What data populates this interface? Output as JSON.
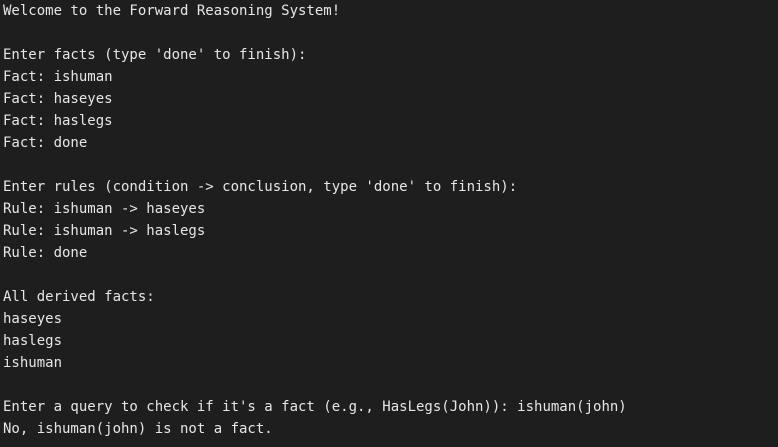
{
  "terminal": {
    "lines": [
      "Welcome to the Forward Reasoning System!",
      "",
      "Enter facts (type 'done' to finish):",
      "Fact: ishuman",
      "Fact: haseyes",
      "Fact: haslegs",
      "Fact: done",
      "",
      "Enter rules (condition -> conclusion, type 'done' to finish):",
      "Rule: ishuman -> haseyes",
      "Rule: ishuman -> haslegs",
      "Rule: done",
      "",
      "All derived facts:",
      "haseyes",
      "haslegs",
      "ishuman",
      "",
      "Enter a query to check if it's a fact (e.g., HasLegs(John)): ishuman(john)",
      "No, ishuman(john) is not a fact."
    ]
  }
}
